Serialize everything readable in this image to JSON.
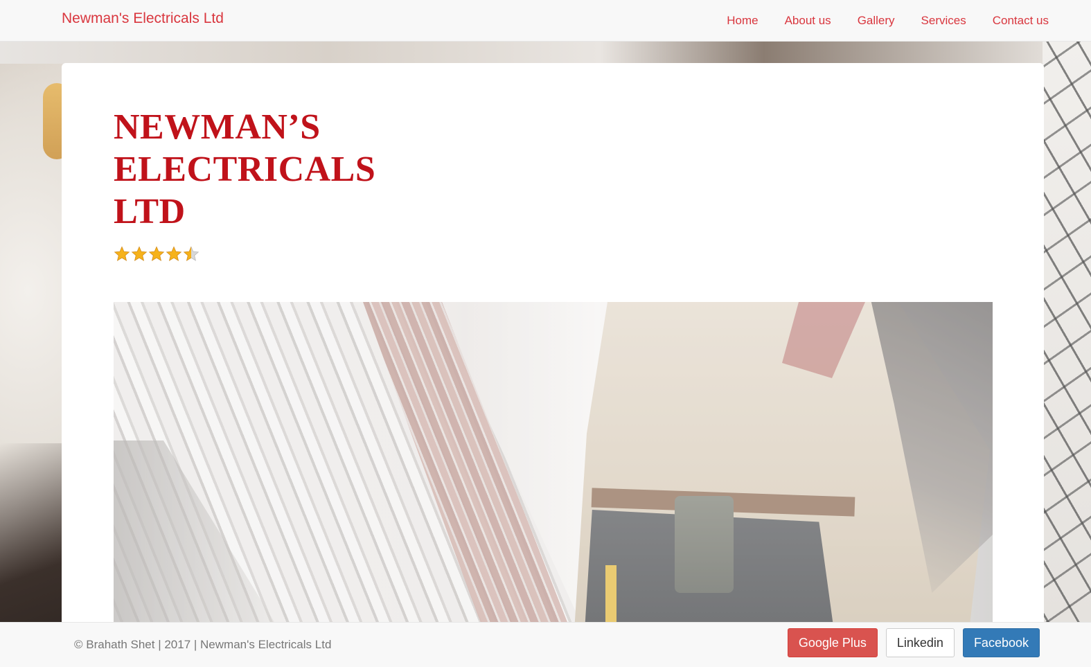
{
  "navbar": {
    "brand": "Newman's Electricals Ltd",
    "links": [
      {
        "label": "Home"
      },
      {
        "label": "About us"
      },
      {
        "label": "Gallery"
      },
      {
        "label": "Services"
      },
      {
        "label": "Contact us"
      }
    ]
  },
  "main": {
    "title": "NEWMAN’S ELECTRICALS LTD",
    "rating": {
      "value": 4.5,
      "max": 5
    },
    "hero_image": "electrician-tool-belt-photo"
  },
  "footer": {
    "copyright": "© Brahath Shet | 2017 | Newman's Electricals Ltd",
    "buttons": [
      {
        "label": "Google Plus"
      },
      {
        "label": "Linkedin"
      },
      {
        "label": "Facebook"
      }
    ]
  },
  "colors": {
    "brand_red": "#d9363e",
    "title_red": "#c0121a",
    "gplus": "#d9534f",
    "facebook": "#337ab7",
    "star": "#f6b21b"
  }
}
